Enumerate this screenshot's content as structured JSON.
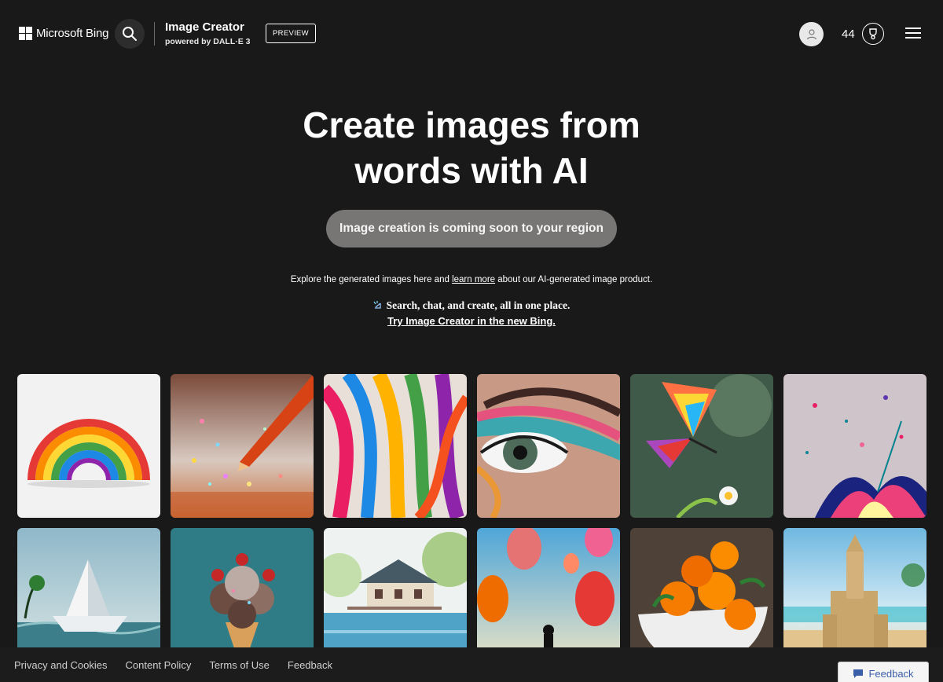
{
  "header": {
    "brand": "Microsoft Bing",
    "product_title": "Image Creator",
    "product_sub": "powered by DALL·E 3",
    "preview_badge": "PREVIEW",
    "coins": "44",
    "icons": [
      "search-icon",
      "user-icon",
      "trophy-icon",
      "menu-icon"
    ]
  },
  "hero": {
    "title_line1": "Create images from",
    "title_line2": "words with AI",
    "coming_soon": "Image creation is coming soon to your region",
    "explore_pre": "Explore the generated images here and ",
    "explore_link": "learn more",
    "explore_post": " about our AI-generated image product.",
    "promo_text": "Search, chat, and create, all in one place.",
    "promo_link": "Try Image Creator in the new Bing."
  },
  "gallery": [
    "rainbow",
    "pencil-sparkles",
    "ribbons",
    "eye-makeup",
    "butterfly",
    "paint-splash",
    "paper-boat",
    "ice-cream",
    "lake-house",
    "hot-air-balloons",
    "oranges",
    "sandcastle"
  ],
  "footer": {
    "links": [
      "Privacy and Cookies",
      "Content Policy",
      "Terms of Use",
      "Feedback"
    ],
    "feedback_button": "Feedback"
  },
  "colors": {
    "background": "#1a1919",
    "button_gray": "#787675",
    "feedback_blue": "#3a5fa8"
  }
}
